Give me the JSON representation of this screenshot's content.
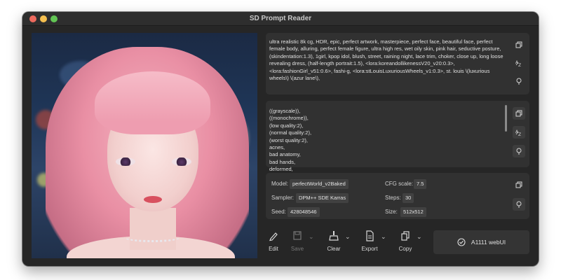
{
  "window": {
    "title": "SD Prompt Reader"
  },
  "prompt": {
    "positive": "ultra realistic 8k cg, HDR, epic, perfect artwork, masterpiece, perfect face, beautiful face, perfect female body, alluring, perfect female figure, ultra high res, wet oily skin, pink hair, seductive posture, (skindentation:1.3), 1girl, kpop idol, blush, street, raining night, lace trim, choker, close up, long loose revealing dress, (half-length portrait:1.5), <lora:koreandollikenessV20_v20:0.3>, <lora:fashionGirl_v51:0.6>, fashi-g, <lora:stLouisLuxuriousWheels_v1:0.3>, st. louis \\(luxurious wheels\\) \\(azur lane\\),",
    "negative": "((grayscale)),\n((monochrome)),\n(low quality:2),\n(normal quality:2),\n(worst quality:2),\nacnes,\nbad anatomy,\nbad hands,\ndeformed,"
  },
  "params": {
    "model_label": "Model:",
    "model": "perfectWorld_v2Baked",
    "sampler_label": "Sampler:",
    "sampler": "DPM++ SDE Karras",
    "seed_label": "Seed:",
    "seed": "428048546",
    "cfg_label": "CFG scale:",
    "cfg": "7.5",
    "steps_label": "Steps:",
    "steps": "30",
    "size_label": "Size:",
    "size": "512x512"
  },
  "toolbar": {
    "edit": "Edit",
    "save": "Save",
    "clear": "Clear",
    "export": "Export",
    "copy": "Copy",
    "webui": "A1111 webUI"
  },
  "icons": {
    "copy": "copy-icon",
    "sort": "sort-icon",
    "pin": "pin-icon",
    "edit": "pencil-icon",
    "save": "save-icon",
    "clear": "broom-icon",
    "export": "document-icon",
    "webui": "check-circle-icon"
  }
}
